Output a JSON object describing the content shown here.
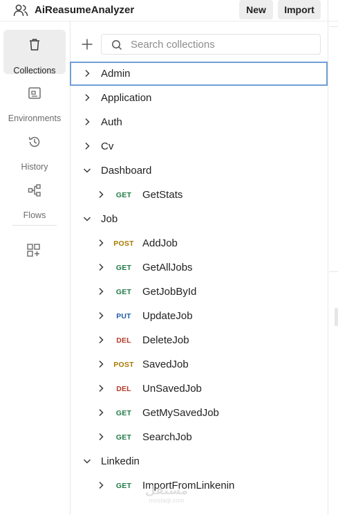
{
  "header": {
    "workspace_title": "AiReasumeAnalyzer",
    "new_label": "New",
    "import_label": "Import"
  },
  "sidebar": {
    "items": [
      {
        "id": "collections",
        "label": "Collections",
        "icon": "trash-can-icon",
        "active": true
      },
      {
        "id": "environments",
        "label": "Environments",
        "icon": "environment-icon",
        "active": false
      },
      {
        "id": "history",
        "label": "History",
        "icon": "history-icon",
        "active": false
      },
      {
        "id": "flows",
        "label": "Flows",
        "icon": "flows-icon",
        "active": false
      }
    ],
    "extra_icon": "add-widget-icon"
  },
  "search": {
    "placeholder": "Search collections"
  },
  "method_colors": {
    "GET": "#1f7a46",
    "POST": "#a87800",
    "PUT": "#1f5ea8",
    "DEL": "#b23a2a"
  },
  "tree": [
    {
      "type": "folder",
      "label": "Admin",
      "expanded": false,
      "selected": true
    },
    {
      "type": "folder",
      "label": "Application",
      "expanded": false
    },
    {
      "type": "folder",
      "label": "Auth",
      "expanded": false
    },
    {
      "type": "folder",
      "label": "Cv",
      "expanded": false
    },
    {
      "type": "folder",
      "label": "Dashboard",
      "expanded": true
    },
    {
      "type": "request",
      "method": "GET",
      "label": "GetStats"
    },
    {
      "type": "folder",
      "label": "Job",
      "expanded": true
    },
    {
      "type": "request",
      "method": "POST",
      "label": "AddJob"
    },
    {
      "type": "request",
      "method": "GET",
      "label": "GetAllJobs"
    },
    {
      "type": "request",
      "method": "GET",
      "label": "GetJobById"
    },
    {
      "type": "request",
      "method": "PUT",
      "label": "UpdateJob"
    },
    {
      "type": "request",
      "method": "DEL",
      "label": "DeleteJob"
    },
    {
      "type": "request",
      "method": "POST",
      "label": "SavedJob"
    },
    {
      "type": "request",
      "method": "DEL",
      "label": "UnSavedJob"
    },
    {
      "type": "request",
      "method": "GET",
      "label": "GetMySavedJob"
    },
    {
      "type": "request",
      "method": "GET",
      "label": "SearchJob"
    },
    {
      "type": "folder",
      "label": "Linkedin",
      "expanded": true
    },
    {
      "type": "request",
      "method": "GET",
      "label": "ImportFromLinkenin"
    }
  ],
  "watermark": {
    "text": "مستقل",
    "sub": "mostaql.com"
  }
}
